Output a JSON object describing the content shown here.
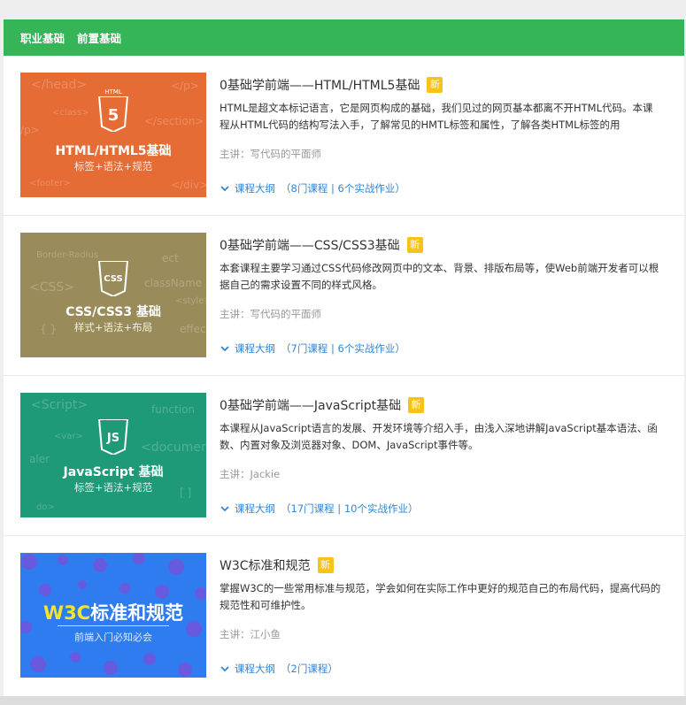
{
  "tabs": [
    {
      "label": "职业基础"
    },
    {
      "label": "前置基础"
    }
  ],
  "courses": [
    {
      "title": "0基础学前端——HTML/HTML5基础",
      "badge": "新",
      "desc": "HTML是超文本标记语言，它是网页构成的基础，我们见过的网页基本都离不开HTML代码。本课程从HTML代码的结构写法入手，了解常见的HMTL标签和属性，了解各类HTML标签的用",
      "teacher": "主讲：写代码的平面师",
      "outline_label": "课程大纲",
      "outline_detail": "8门课程 | 6个实战作业",
      "thumb": {
        "bg": "#e66c36",
        "icon_text": "HTML",
        "icon_glyph": "5",
        "title": "HTML/HTML5基础",
        "sub": "标签+语法+规范",
        "deco": [
          "</head>",
          "</p>",
          "<class>",
          "</section>",
          "<footer>",
          "</div>",
          "/p>"
        ]
      }
    },
    {
      "title": "0基础学前端——CSS/CSS3基础",
      "badge": "新",
      "desc": "本套课程主要学习通过CSS代码修改网页中的文本、背景、排版布局等，使Web前端开发者可以根据自己的需求设置不同的样式风格。",
      "teacher": "主讲：写代码的平面师",
      "outline_label": "课程大纲",
      "outline_detail": "7门课程 | 6个实战作业",
      "thumb": {
        "bg": "#9a8c5a",
        "icon_text": "",
        "icon_glyph": "CSS",
        "title": "CSS/CSS3 基础",
        "sub": "样式+语法+布局",
        "deco": [
          "Border-Radius",
          "<CSS>",
          "className",
          "<style>",
          "{ }",
          "effect",
          "ect"
        ]
      }
    },
    {
      "title": "0基础学前端——JavaScript基础",
      "badge": "新",
      "desc": "本课程从JavaScript语言的发展、开发环境等介绍入手，由浅入深地讲解JavaScript基本语法、函数、内置对象及浏览器对象、DOM、JavaScript事件等。",
      "teacher": "主讲：Jackie",
      "outline_label": "课程大纲",
      "outline_detail": "17门课程 | 10个实战作业",
      "thumb": {
        "bg": "#1f9a78",
        "icon_text": "",
        "icon_glyph": "JS",
        "title": "JavaScript 基础",
        "sub": "标签+语法+规范",
        "deco": [
          "<Script>",
          "function",
          "<var>",
          "<document",
          "aler",
          "[ ]",
          "do>"
        ]
      }
    },
    {
      "title": "W3C标准和规范",
      "badge": "新",
      "desc": "掌握W3C的一些常用标准与规范，学会如何在实际工作中更好的规范自己的布局代码，提高代码的规范性和可维护性。",
      "teacher": "主讲：江小鱼",
      "outline_label": "课程大纲",
      "outline_detail": "2门课程",
      "thumb": {
        "bg": "#2e7cf0",
        "title_a": "W3C",
        "title_b": "标准和规范",
        "sub": "前端入门必知必会"
      }
    }
  ]
}
